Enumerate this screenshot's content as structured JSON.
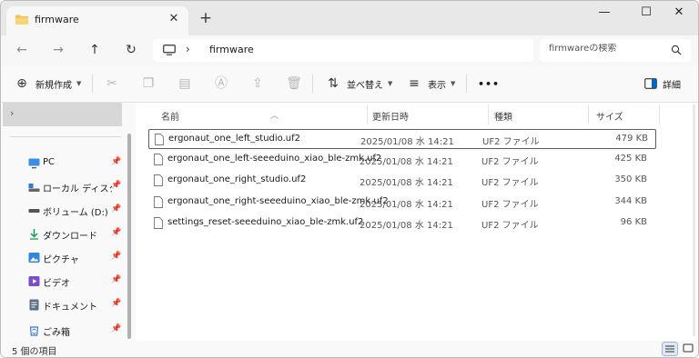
{
  "tab": {
    "title": "firmware",
    "close": "✕",
    "new_tab": "+"
  },
  "window_controls": {
    "minimize": "—",
    "maximize": "☐",
    "close": "✕"
  },
  "address": {
    "separator": "›",
    "path": "firmware"
  },
  "search": {
    "placeholder": "firmwareの検索"
  },
  "commands": {
    "new": "新規作成",
    "sort": "並べ替え",
    "view": "表示",
    "more": "•••",
    "details": "詳細"
  },
  "sidebar": {
    "expand": "›",
    "items": [
      {
        "label": "PC",
        "icon": "monitor-icon"
      },
      {
        "label": "ローカル ディスク (C:",
        "icon": "drive-icon"
      },
      {
        "label": "ボリューム (D:)",
        "icon": "drive-icon"
      },
      {
        "label": "ダウンロード",
        "icon": "download-icon"
      },
      {
        "label": "ピクチャ",
        "icon": "picture-icon"
      },
      {
        "label": "ビデオ",
        "icon": "video-icon"
      },
      {
        "label": "ドキュメント",
        "icon": "document-icon"
      },
      {
        "label": "ごみ箱",
        "icon": "recycle-bin-icon"
      }
    ]
  },
  "columns": {
    "name": "名前",
    "date": "更新日時",
    "type": "種類",
    "size": "サイズ"
  },
  "files": [
    {
      "name": "ergonaut_one_left_studio.uf2",
      "date": "2025/01/08 水 14:21",
      "type": "UF2 ファイル",
      "size": "479 KB"
    },
    {
      "name": "ergonaut_one_left-seeeduino_xiao_ble-zmk.uf2",
      "date": "2025/01/08 水 14:21",
      "type": "UF2 ファイル",
      "size": "425 KB"
    },
    {
      "name": "ergonaut_one_right_studio.uf2",
      "date": "2025/01/08 水 14:21",
      "type": "UF2 ファイル",
      "size": "350 KB"
    },
    {
      "name": "ergonaut_one_right-seeeduino_xiao_ble-zmk.uf2",
      "date": "2025/01/08 水 14:21",
      "type": "UF2 ファイル",
      "size": "344 KB"
    },
    {
      "name": "settings_reset-seeeduino_xiao_ble-zmk.uf2",
      "date": "2025/01/08 水 14:21",
      "type": "UF2 ファイル",
      "size": "96 KB"
    }
  ],
  "status": {
    "count": "5 個の項目"
  },
  "colors": {
    "folder": "#f2c14e",
    "accent": "#0067c0",
    "selected_border": "#5c5c5c"
  }
}
